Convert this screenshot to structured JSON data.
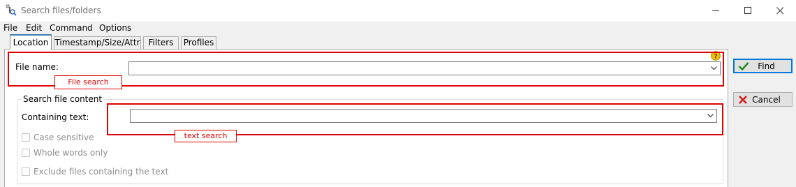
{
  "window": {
    "title": "Search files/folders"
  },
  "menu": [
    "File",
    "Edit",
    "Command",
    "Options"
  ],
  "tabs": [
    "Location",
    "Timestamp/Size/Attr",
    "Filters",
    "Profiles"
  ],
  "location": {
    "file_name_label": "File name:",
    "file_name_value": "",
    "group_title": "Search file content",
    "containing_label": "Containing text:",
    "containing_value": "",
    "checkboxes": [
      {
        "label": "Case sensitive",
        "checked": false
      },
      {
        "label": "Whole words only",
        "checked": false
      },
      {
        "label": "Exclude files containing the text",
        "checked": false
      }
    ]
  },
  "annotations": {
    "file_search": "File search",
    "text_search": "text search",
    "color": "#e00000"
  },
  "buttons": {
    "find": "Find",
    "cancel": "Cancel"
  },
  "icons": {
    "app": "app-icon",
    "help": "help-icon",
    "find": "checkmark-icon",
    "cancel": "red-x-icon"
  }
}
